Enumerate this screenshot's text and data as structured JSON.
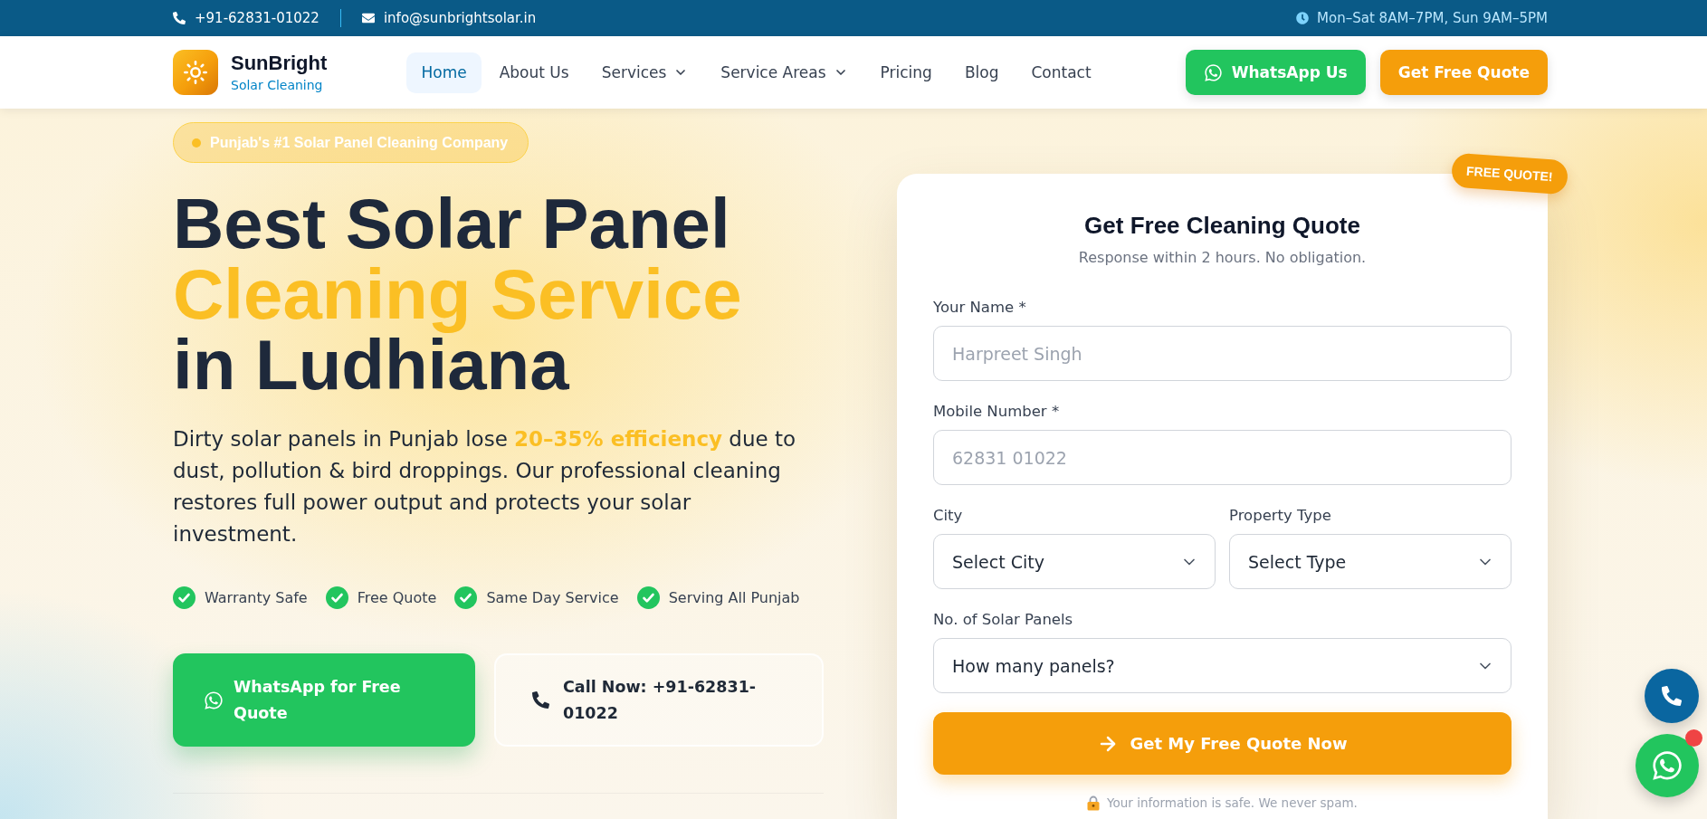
{
  "top_bar": {
    "phone": "+91-62831-01022",
    "email": "info@sunbrightsolar.in",
    "hours": "Mon–Sat 8AM–7PM, Sun 9AM–5PM"
  },
  "nav": {
    "brand": {
      "name": "SunBright",
      "tagline": "Solar Cleaning"
    },
    "links": [
      {
        "label": "Home",
        "selected": true,
        "dropdown": false
      },
      {
        "label": "About Us",
        "selected": false,
        "dropdown": false
      },
      {
        "label": "Services",
        "selected": false,
        "dropdown": true
      },
      {
        "label": "Service Areas",
        "selected": false,
        "dropdown": true
      },
      {
        "label": "Pricing",
        "selected": false,
        "dropdown": false
      },
      {
        "label": "Blog",
        "selected": false,
        "dropdown": false
      },
      {
        "label": "Contact",
        "selected": false,
        "dropdown": false
      }
    ],
    "buttons": [
      {
        "kind": "whatsapp",
        "label": "WhatsApp Us"
      },
      {
        "kind": "quote",
        "label": "Get Free Quote"
      }
    ]
  },
  "hero": {
    "badge": "Punjab's #1 Solar Panel Cleaning Company",
    "headline": [
      {
        "text": "Best Solar Panel",
        "highlight": false
      },
      {
        "text": "Cleaning Service",
        "highlight": true
      },
      {
        "text": "in Ludhiana",
        "highlight": false
      }
    ],
    "description": "Dirty solar panels in Punjab lose **20–35% efficiency** due to dust, pollution & bird droppings. Our professional cleaning restores full power output and protects your solar investment.",
    "features": [
      "Warranty Safe",
      "Free Quote",
      "Same Day Service",
      "Serving All Punjab"
    ],
    "buttons": [
      {
        "kind": "whatsapp",
        "label": "WhatsApp for Free Quote"
      },
      {
        "kind": "call",
        "label": "Call Now: +91-62831-01022"
      }
    ]
  },
  "quote_form": {
    "ribbon": "FREE QUOTE!",
    "title": "Get Free Cleaning Quote",
    "subtitle": "Response within 2 hours. No obligation.",
    "rows": [
      {
        "fields": [
          {
            "kind": "input",
            "label": "Your Name *",
            "placeholder": "Harpreet Singh"
          }
        ]
      },
      {
        "fields": [
          {
            "kind": "input",
            "label": "Mobile Number *",
            "placeholder": "62831 01022"
          }
        ]
      },
      {
        "fields": [
          {
            "kind": "select",
            "label": "City",
            "value": "Select City"
          },
          {
            "kind": "select",
            "label": "Property Type",
            "value": "Select Type"
          }
        ]
      },
      {
        "fields": [
          {
            "kind": "select",
            "label": "No. of Solar Panels",
            "value": "How many panels?"
          }
        ]
      }
    ],
    "submit": "Get My Free Quote Now",
    "privacy_note": "Your information is safe. We never spam."
  },
  "floating_buttons": [
    {
      "kind": "call",
      "unread": false
    },
    {
      "kind": "whatsapp",
      "unread": true
    }
  ]
}
